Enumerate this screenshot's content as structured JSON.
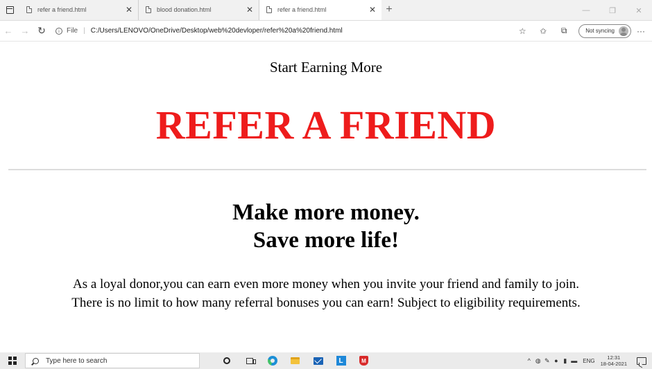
{
  "browser": {
    "tabs": [
      {
        "title": "refer a friend.html",
        "active": false
      },
      {
        "title": "blood donation.html",
        "active": false
      },
      {
        "title": "refer a friend.html",
        "active": true
      }
    ],
    "close_glyph": "✕",
    "new_tab_glyph": "+",
    "window_controls": {
      "minimize": "—",
      "restore": "❐",
      "close": "✕"
    },
    "address": {
      "protocol_label": "File",
      "url": "C:/Users/LENOVO/OneDrive/Desktop/web%20devloper/refer%20a%20friend.html"
    },
    "profile": {
      "sync_label": "Not syncing"
    }
  },
  "page": {
    "tagline": "Start Earning More",
    "headline": "REFER A FRIEND",
    "headline_color": "#ee1c1c",
    "subheadline_line1": "Make more money.",
    "subheadline_line2": "Save more life!",
    "body_line1": "As a loyal donor,you can earn even more money when you invite your friend and family to join.",
    "body_line2": "There is no limit to how many referral bonuses you can earn! Subject to eligibility requirements."
  },
  "taskbar": {
    "search_placeholder": "Type here to search",
    "apps": [
      "cortana-icon",
      "task-view-icon",
      "edge-icon",
      "file-explorer-icon",
      "mail-icon",
      "lenovo-vantage-icon",
      "mcafee-icon"
    ],
    "tray": {
      "language": "ENG",
      "time": "12:31",
      "date": "18-04-2021"
    }
  }
}
